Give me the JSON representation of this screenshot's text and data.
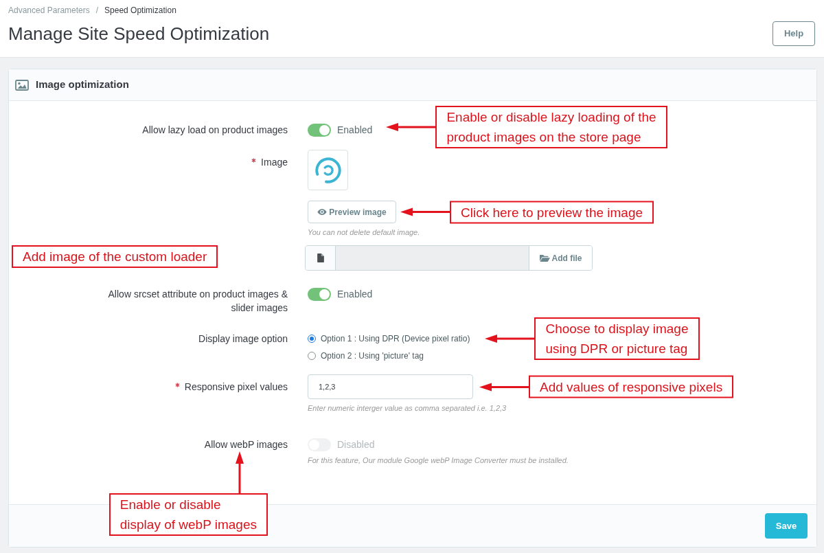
{
  "breadcrumb": {
    "separator": "/",
    "items": [
      {
        "label": "Advanced Parameters",
        "current": false
      },
      {
        "label": "Speed Optimization",
        "current": true
      }
    ]
  },
  "page_title": "Manage Site Speed Optimization",
  "help_button": "Help",
  "panel": {
    "title": "Image optimization",
    "fields": [
      {
        "kind": "switch",
        "label": "Allow lazy load on product images",
        "required": false,
        "on": true,
        "disabled": false,
        "state_label": "Enabled",
        "annotations": [
          {
            "kind": "left",
            "lines": [
              "Enable or disable lazy loading of the",
              "product images on the store page"
            ]
          }
        ]
      },
      {
        "kind": "image",
        "label": "Image",
        "required": true,
        "preview_button": "Preview image",
        "hint": "You can not delete default image.",
        "file_button": "Add file",
        "annotations": [
          {
            "kind": "left",
            "lines": [
              "Click here to preview the image"
            ]
          },
          {
            "kind": "plain",
            "lines": [
              "Add image of the custom loader"
            ]
          }
        ]
      },
      {
        "kind": "switch",
        "label": "Allow srcset attribute on product images & slider images",
        "required": false,
        "on": true,
        "disabled": false,
        "state_label": "Enabled"
      },
      {
        "kind": "radio",
        "label": "Display image option",
        "required": false,
        "options": [
          {
            "label": "Option 1 : Using DPR (Device pixel ratio)",
            "selected": true
          },
          {
            "label": "Option 2 : Using 'picture' tag",
            "selected": false
          }
        ],
        "annotations": [
          {
            "kind": "left",
            "lines": [
              "Choose to display image",
              "using DPR or picture tag"
            ]
          }
        ]
      },
      {
        "kind": "text",
        "label": "Responsive pixel values",
        "required": true,
        "value": "1,2,3",
        "hint": "Enter numeric interger value as comma separated i.e. 1,2,3",
        "annotations": [
          {
            "kind": "left",
            "lines": [
              "Add values of responsive pixels"
            ]
          }
        ]
      },
      {
        "kind": "switch",
        "label": "Allow webP images",
        "required": false,
        "on": false,
        "disabled": true,
        "state_label": "Disabled",
        "hint": "For this feature, Our module Google webP Image Converter must be installed.",
        "annotations": [
          {
            "kind": "up",
            "lines": [
              "Enable or disable",
              "display of webP images"
            ]
          }
        ]
      }
    ],
    "save_button": "Save"
  }
}
